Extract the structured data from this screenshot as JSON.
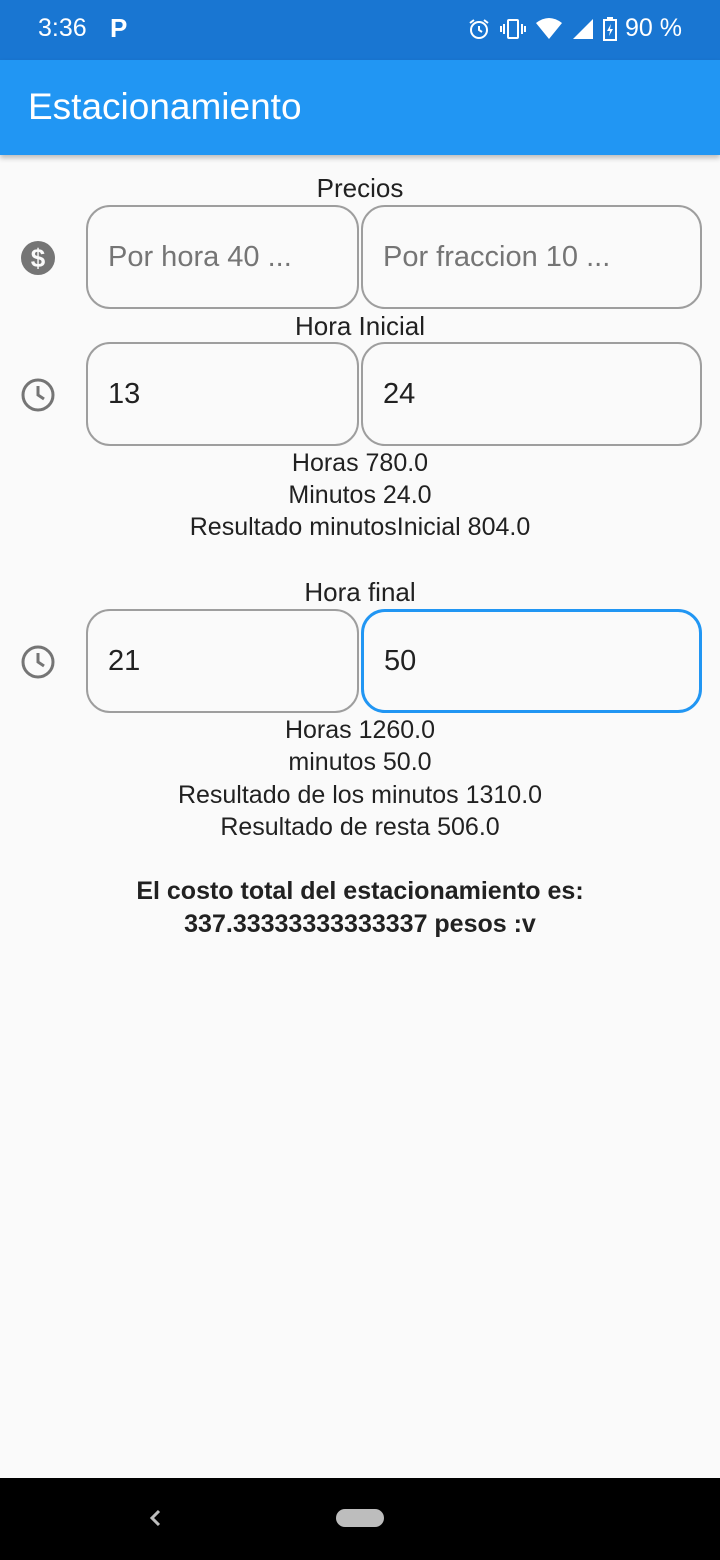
{
  "status_bar": {
    "time": "3:36",
    "app_indicator": "P",
    "battery": "90 %"
  },
  "app_bar": {
    "title": "Estacionamiento"
  },
  "precios": {
    "label": "Precios",
    "icon": "dollar-icon",
    "por_hora_placeholder": "Por hora 40 ...",
    "por_fraccion_placeholder": "Por fraccion 10 ..."
  },
  "hora_inicial": {
    "label": "Hora Inicial",
    "icon": "clock-icon",
    "hours_value": "13",
    "minutes_value": "24",
    "horas_text": "Horas 780.0",
    "minutos_text": "Minutos 24.0",
    "resultado_text": "Resultado minutosInicial 804.0"
  },
  "hora_final": {
    "label": "Hora final",
    "icon": "clock-icon",
    "hours_value": "21",
    "minutes_value": "50",
    "horas_text": "Horas 1260.0",
    "minutos_text": "minutos 50.0",
    "resultado_text": "Resultado de los minutos 1310.0",
    "resta_text": "Resultado de resta 506.0"
  },
  "total": {
    "line1": "El costo total del estacionamiento es:",
    "line2": "337.33333333333337 pesos :v"
  },
  "colors": {
    "status_bar": "#1976d2",
    "app_bar": "#2196f3",
    "focus": "#2196f3"
  }
}
